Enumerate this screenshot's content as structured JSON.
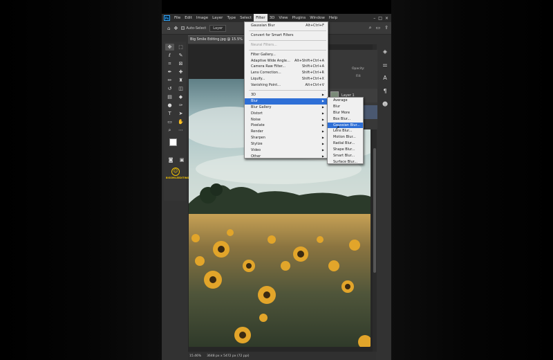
{
  "app": {
    "logo": "Ps",
    "menu": [
      "File",
      "Edit",
      "Image",
      "Layer",
      "Type",
      "Select",
      "Filter",
      "3D",
      "View",
      "Plugins",
      "Window",
      "Help"
    ],
    "active_menu": "Filter"
  },
  "options_bar": {
    "auto_select_label": "Auto-Select",
    "target_value": "Layer"
  },
  "document": {
    "tab_title": "Big Smile Editing.jpg @ 15.5% (L"
  },
  "status": {
    "zoom": "15.46%",
    "doc_info": "3648 px x 5472 px (72 ppi)"
  },
  "layers_panel": {
    "opacity_label": "Opacity:",
    "fill_label": "Fill:",
    "layer_name": "Layer 1"
  },
  "toolbar": {
    "badge_text": "BIGSMILEEDITING"
  },
  "filter_menu": {
    "top": [
      {
        "label": "Gaussian Blur",
        "shortcut": "Alt+Ctrl+F",
        "disabled": false
      }
    ],
    "group2": [
      {
        "label": "Convert for Smart Filters",
        "shortcut": "",
        "disabled": false
      }
    ],
    "group3": [
      {
        "label": "Neural Filters...",
        "shortcut": "",
        "disabled": true
      }
    ],
    "group4": [
      {
        "label": "Filter Gallery...",
        "shortcut": ""
      },
      {
        "label": "Adaptive Wide Angle...",
        "shortcut": "Alt+Shift+Ctrl+A"
      },
      {
        "label": "Camera Raw Filter...",
        "shortcut": "Shift+Ctrl+A"
      },
      {
        "label": "Lens Correction...",
        "shortcut": "Shift+Ctrl+R"
      },
      {
        "label": "Liquify...",
        "shortcut": "Shift+Ctrl+X"
      },
      {
        "label": "Vanishing Point...",
        "shortcut": "Alt+Ctrl+V"
      }
    ],
    "group5": [
      {
        "label": "3D"
      },
      {
        "label": "Blur"
      },
      {
        "label": "Blur Gallery"
      },
      {
        "label": "Distort"
      },
      {
        "label": "Noise"
      },
      {
        "label": "Pixelate"
      },
      {
        "label": "Render"
      },
      {
        "label": "Sharpen"
      },
      {
        "label": "Stylize"
      },
      {
        "label": "Video"
      },
      {
        "label": "Other"
      }
    ],
    "highlighted": "Blur"
  },
  "blur_submenu": {
    "items": [
      "Average",
      "Blur",
      "Blur More",
      "Box Blur...",
      "Gaussian Blur...",
      "Lens Blur...",
      "Motion Blur...",
      "Radial Blur...",
      "Shape Blur...",
      "Smart Blur...",
      "Surface Blur..."
    ],
    "highlighted": "Gaussian Blur..."
  },
  "colors": {
    "highlight": "#2e6fd6",
    "menu_bg": "#f0f0f0",
    "app_bg": "#323232"
  }
}
